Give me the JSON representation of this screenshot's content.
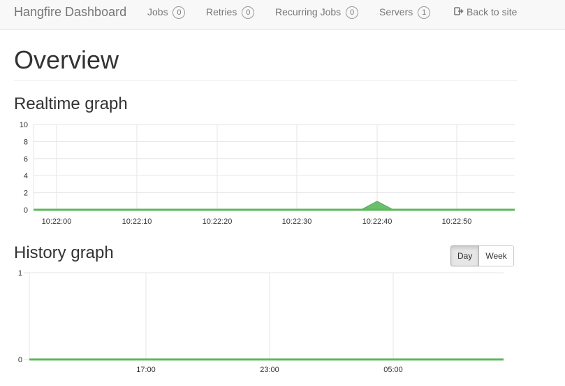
{
  "navbar": {
    "brand": "Hangfire Dashboard",
    "items": [
      {
        "label": "Jobs",
        "count": "0"
      },
      {
        "label": "Retries",
        "count": "0"
      },
      {
        "label": "Recurring Jobs",
        "count": "0"
      },
      {
        "label": "Servers",
        "count": "1"
      }
    ],
    "back_label": "Back to site",
    "back_icon": "sign-out-icon"
  },
  "page": {
    "title": "Overview"
  },
  "realtime": {
    "title": "Realtime graph",
    "chart_data": {
      "type": "area",
      "y_ticks": [
        "10",
        "8",
        "6",
        "4",
        "2",
        "0"
      ],
      "ylim": [
        0,
        10
      ],
      "x_ticks": [
        "10:22:00",
        "10:22:10",
        "10:22:20",
        "10:22:30",
        "10:22:40",
        "10:22:50"
      ],
      "series": [
        {
          "color": "#5cb85c",
          "peak_at": "10:22:40",
          "peak_value": 1,
          "baseline": 0
        }
      ],
      "grid": true
    }
  },
  "history": {
    "title": "History graph",
    "buttons": {
      "day": "Day",
      "week": "Week"
    },
    "active_range": "Day",
    "chart_data": {
      "type": "line",
      "y_ticks": [
        "1",
        "0"
      ],
      "ylim": [
        0,
        1
      ],
      "x_ticks": [
        "17:00",
        "23:00",
        "05:00"
      ],
      "series": [
        {
          "color": "#5cb85c",
          "values": "all 0"
        }
      ],
      "grid": true
    }
  }
}
